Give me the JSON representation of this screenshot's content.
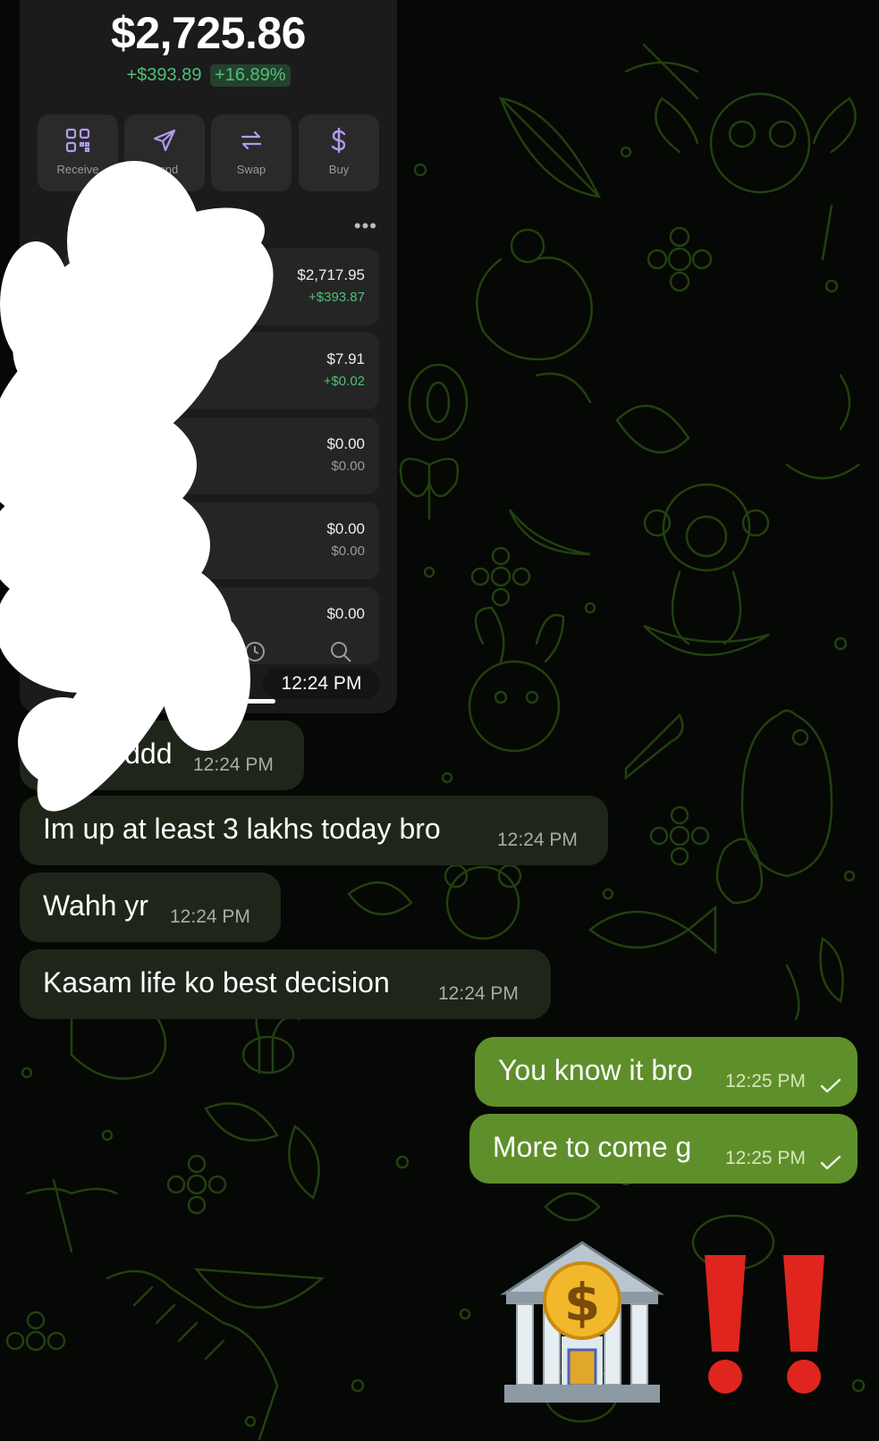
{
  "wallet": {
    "balance": "$2,725.86",
    "change_amount": "+$393.89",
    "change_percent": "+16.89%",
    "actions": [
      {
        "label": "Receive",
        "icon": "qr-code-icon"
      },
      {
        "label": "Send",
        "icon": "send-icon"
      },
      {
        "label": "Swap",
        "icon": "swap-icon"
      },
      {
        "label": "Buy",
        "icon": "dollar-icon"
      }
    ],
    "tokens": [
      {
        "value": "$2,717.95",
        "change": "+$393.87",
        "positive": true
      },
      {
        "value": "$7.91",
        "change": "+$0.02",
        "positive": true
      },
      {
        "value": "$0.00",
        "change": "$0.00",
        "positive": false
      },
      {
        "value": "$0.00",
        "change": "$0.00",
        "positive": false
      },
      {
        "value": "$0.00",
        "change": "",
        "positive": false
      }
    ],
    "photo_time": "12:24 PM",
    "colors": {
      "positive": "#4fbf78",
      "card": "#1b1b1b",
      "tile": "#252525"
    }
  },
  "messages": [
    {
      "text": "siddd",
      "time": "12:24 PM",
      "direction": "incoming"
    },
    {
      "text": "Im up at least 3 lakhs today bro",
      "time": "12:24 PM",
      "direction": "incoming"
    },
    {
      "text": "Wahh yr",
      "time": "12:24 PM",
      "direction": "incoming"
    },
    {
      "text": "Kasam life ko best decision",
      "time": "12:24 PM",
      "direction": "incoming"
    },
    {
      "text": "You know it bro",
      "time": "12:25 PM",
      "direction": "outgoing",
      "status": "sent-check-icon"
    },
    {
      "text": "More to come g",
      "time": "12:25 PM",
      "direction": "outgoing",
      "status": "sent-check-icon"
    }
  ],
  "emojis": [
    "bank-emoji",
    "double-exclamation-emoji"
  ],
  "colors": {
    "incoming_bubble": "#1f2619",
    "outgoing_bubble": "#5f8f2b",
    "wallpaper_doodle": "#1f3a0e"
  }
}
